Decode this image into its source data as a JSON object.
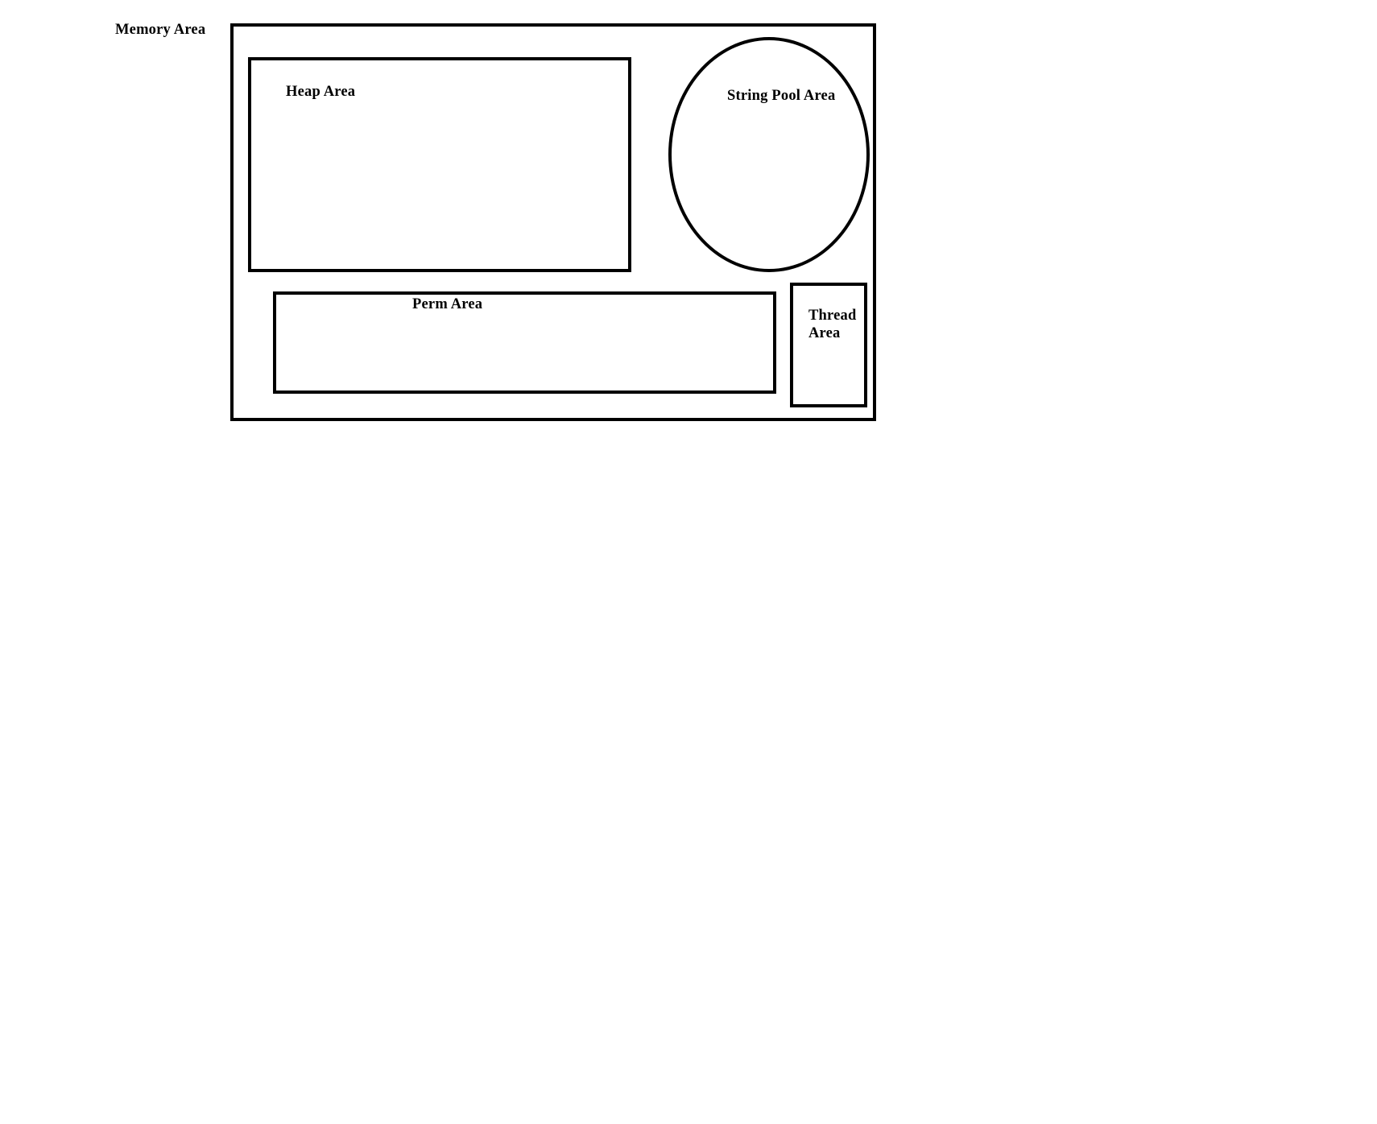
{
  "diagram": {
    "outer_label": "Memory Area",
    "regions": {
      "heap": {
        "label": "Heap Area",
        "shape": "rectangle"
      },
      "string_pool": {
        "label": "String Pool Area",
        "shape": "ellipse"
      },
      "perm": {
        "label": "Perm Area",
        "shape": "rectangle"
      },
      "thread": {
        "label_line1": "Thread",
        "label_line2": "Area",
        "shape": "rectangle"
      }
    },
    "colors": {
      "stroke": "#000000",
      "background": "#ffffff"
    }
  }
}
